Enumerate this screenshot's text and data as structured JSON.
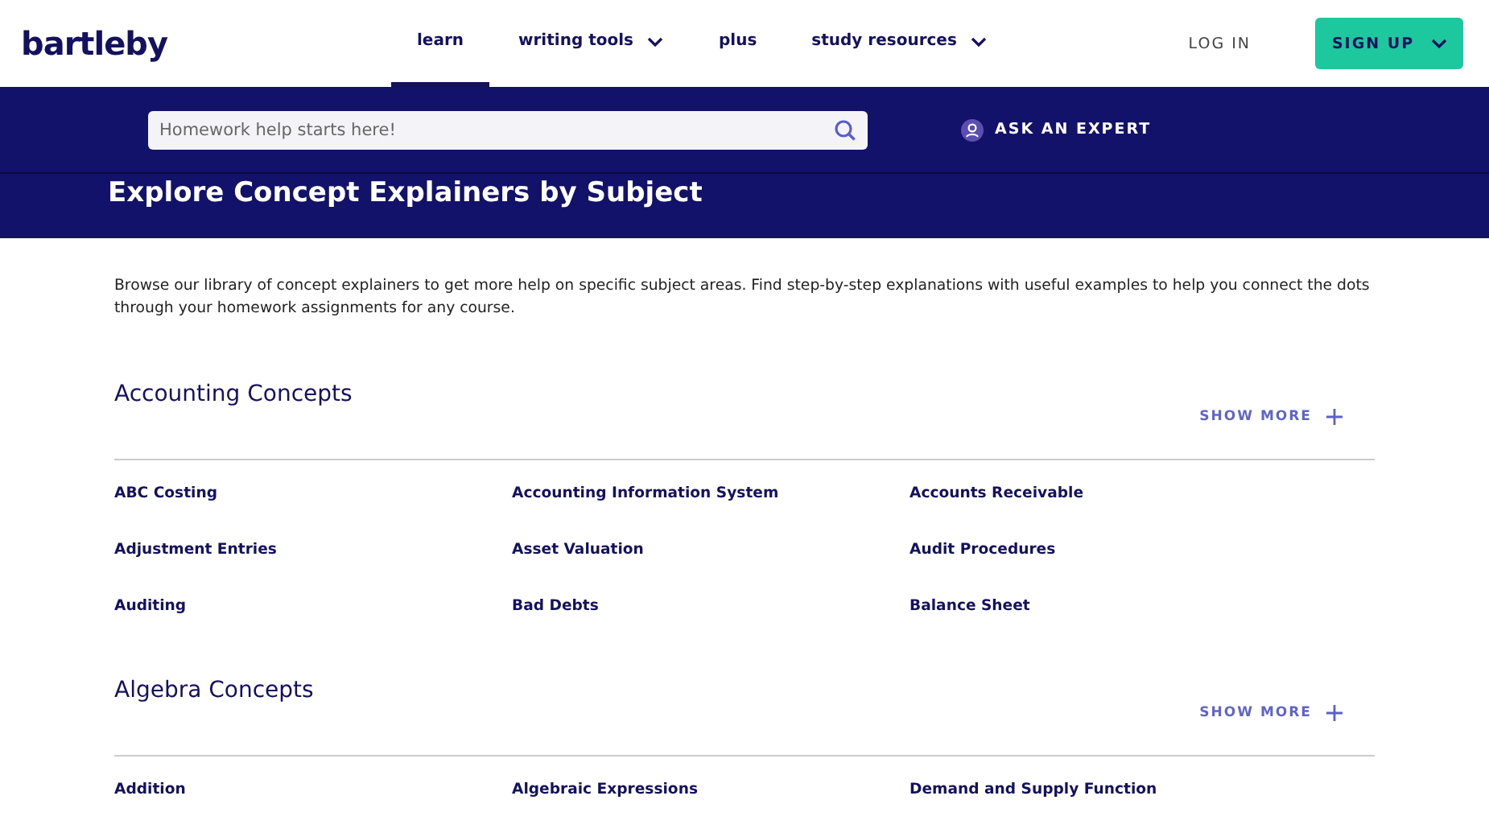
{
  "logo": "bartleby",
  "nav": [
    {
      "label": "learn",
      "selected": true,
      "dropdown": false
    },
    {
      "label": "writing tools",
      "selected": false,
      "dropdown": true
    },
    {
      "label": "plus",
      "selected": false,
      "dropdown": false
    },
    {
      "label": "study resources",
      "selected": false,
      "dropdown": true
    }
  ],
  "login": "LOG IN",
  "signup": "SIGN UP",
  "search": {
    "placeholder": "Homework help starts here!"
  },
  "ask_expert": "ASK AN EXPERT",
  "page_title": "Explore Concept Explainers by Subject",
  "intro": "Browse our library of concept explainers to get more help on specific subject areas. Find step-by-step explanations with useful examples to help you connect the dots through your homework assignments for any course.",
  "sections": [
    {
      "title": "Accounting Concepts",
      "show_more": "SHOW MORE",
      "items": [
        "ABC Costing",
        "Accounting Information System",
        "Accounts Receivable",
        "Adjustment Entries",
        "Asset Valuation",
        "Audit Procedures",
        "Auditing",
        "Bad Debts",
        "Balance Sheet"
      ]
    },
    {
      "title": "Algebra Concepts",
      "show_more": "SHOW MORE",
      "items": [
        "Addition",
        "Algebraic Expressions",
        "Demand and Supply Function"
      ]
    }
  ]
}
